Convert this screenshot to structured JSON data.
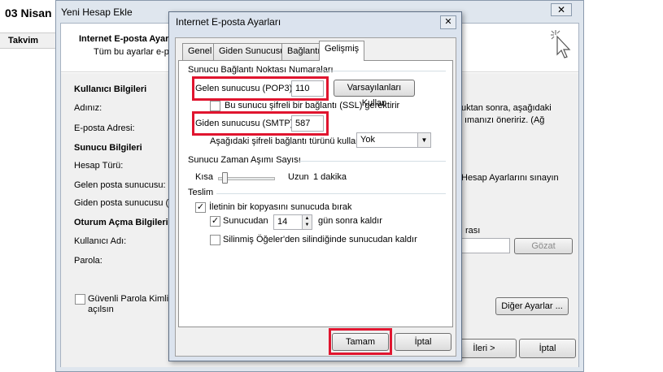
{
  "background": {
    "date": "03 Nisan",
    "takvim": "Takvim"
  },
  "wizard": {
    "title": "Yeni Hesap Ekle",
    "close": "✕",
    "heading": "Internet E-posta Ayar",
    "subheading": "Tüm bu ayarlar e-po",
    "sections": {
      "user_info": "Kullanıcı Bilgileri",
      "name_label": "Adınız:",
      "email_label": "E-posta Adresi:",
      "server_info": "Sunucu Bilgileri",
      "account_type_label": "Hesap Türü:",
      "incoming_label": "Gelen posta sunucusu:",
      "outgoing_label": "Giden posta sunucusu (SM",
      "logon_info": "Oturum Açma Bilgileri",
      "username_label": "Kullanıcı Adı:",
      "password_label": "Parola:",
      "spa_line1": "Güvenli Parola Kimlik Do",
      "spa_line2": "açılsın"
    },
    "right_text": {
      "line1": "uktan sonra, aşağıdaki",
      "line2": "ımanızı öneririz. (Ağ",
      "line3": "Hesap Ayarlarını sınayın",
      "line4": "rası"
    },
    "browse_button": "Gözat",
    "more_settings_button": "Diğer Ayarlar ...",
    "next_button": "İleri >",
    "cancel_button": "İptal"
  },
  "dialog": {
    "title": "Internet E-posta Ayarları",
    "close": "✕",
    "tabs": [
      "Genel",
      "Giden Sunucusu",
      "Bağlantı",
      "Gelişmiş"
    ],
    "active_tab": "Gelişmiş",
    "port_group": "Sunucu Bağlantı Noktası Numaraları",
    "incoming_label": "Gelen sunucusu (POP3):",
    "incoming_value": "110",
    "defaults_button": "Varsayılanları Kullan",
    "ssl_label": "Bu sunucu şifreli bir bağlantı (SSL) gerektirir",
    "outgoing_label": "Giden sunucusu (SMTP):",
    "outgoing_value": "587",
    "encryption_label": "Aşağıdaki şifreli bağlantı türünü kullan:",
    "encryption_value": "Yok",
    "timeout_group": "Sunucu Zaman Aşımı Sayısı",
    "timeout_short": "Kısa",
    "timeout_long": "Uzun",
    "timeout_value": "1 dakika",
    "delivery_group": "Teslim",
    "leave_copy_label": "İletinin bir kopyasını sunucuda bırak",
    "remove_after_label": "Sunucudan",
    "remove_after_days": "14",
    "remove_after_suffix": "gün sonra kaldır",
    "remove_deleted_label": "Silinmiş Öğeler'den silindiğinde sunucudan kaldır",
    "ok_button": "Tamam",
    "cancel_button": "İptal"
  },
  "colors": {
    "highlight": "#e0152f"
  }
}
